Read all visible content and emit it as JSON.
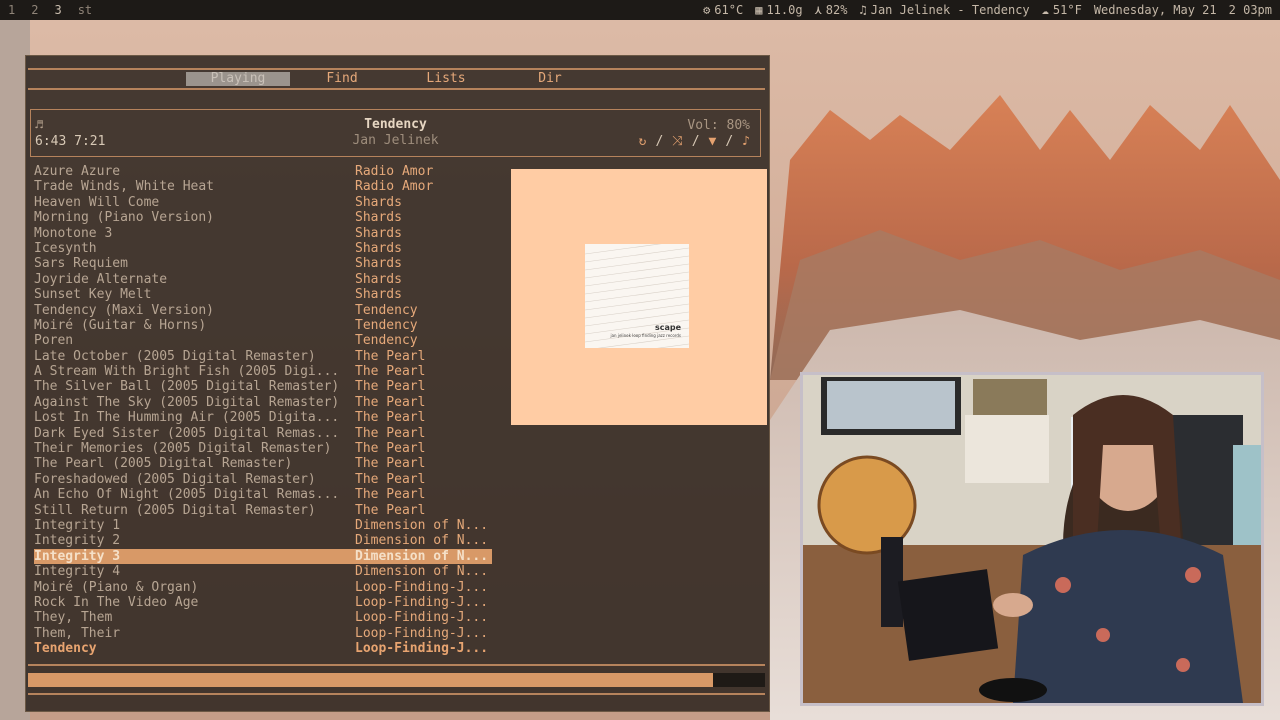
{
  "topbar": {
    "workspaces": [
      "1",
      "2",
      "3",
      "st"
    ],
    "temperature": "61°C",
    "memory": "11.0g",
    "brightness": "82%",
    "now_playing": "Jan Jelinek - Tendency",
    "weather": "51°F",
    "date": "Wednesday, May 21",
    "time": "2 03pm"
  },
  "player": {
    "tabs": [
      "Playing",
      "Find",
      "Lists",
      "Dir"
    ],
    "active_tab": "Playing",
    "title": "Tendency",
    "artist": "Jan Jelinek",
    "elapsed": "6:43",
    "duration": "7:21",
    "time_display": "6:43 7:21",
    "volume": "Vol: 80%",
    "progress": 0.93,
    "selected_index": 25,
    "playing_index": 31,
    "tracks": [
      {
        "title": "Azure Azure",
        "album": "Radio Amor"
      },
      {
        "title": "Trade Winds, White Heat",
        "album": "Radio Amor"
      },
      {
        "title": "Heaven Will Come",
        "album": "Shards"
      },
      {
        "title": "Morning (Piano Version)",
        "album": "Shards"
      },
      {
        "title": "Monotone 3",
        "album": "Shards"
      },
      {
        "title": "Icesynth",
        "album": "Shards"
      },
      {
        "title": "Sars Requiem",
        "album": "Shards"
      },
      {
        "title": "Joyride Alternate",
        "album": "Shards"
      },
      {
        "title": "Sunset Key Melt",
        "album": "Shards"
      },
      {
        "title": "Tendency (Maxi Version)",
        "album": "Tendency"
      },
      {
        "title": "Moiré (Guitar & Horns)",
        "album": "Tendency"
      },
      {
        "title": "Poren",
        "album": "Tendency"
      },
      {
        "title": "Late October (2005 Digital Remaster)",
        "album": "The Pearl"
      },
      {
        "title": "A Stream With Bright Fish (2005 Digi...",
        "album": "The Pearl"
      },
      {
        "title": "The Silver Ball (2005 Digital Remaster)",
        "album": "The Pearl"
      },
      {
        "title": "Against The Sky (2005 Digital Remaster)",
        "album": "The Pearl"
      },
      {
        "title": "Lost In The Humming Air (2005 Digita...",
        "album": "The Pearl"
      },
      {
        "title": "Dark Eyed Sister (2005 Digital Remas...",
        "album": "The Pearl"
      },
      {
        "title": "Their Memories (2005 Digital Remaster)",
        "album": "The Pearl"
      },
      {
        "title": "The Pearl (2005 Digital Remaster)",
        "album": "The Pearl"
      },
      {
        "title": "Foreshadowed (2005 Digital Remaster)",
        "album": "The Pearl"
      },
      {
        "title": "An Echo Of Night (2005 Digital Remas...",
        "album": "The Pearl"
      },
      {
        "title": "Still Return (2005 Digital Remaster)",
        "album": "The Pearl"
      },
      {
        "title": "Integrity 1",
        "album": "Dimension of N..."
      },
      {
        "title": "Integrity 2",
        "album": "Dimension of N..."
      },
      {
        "title": "Integrity 3",
        "album": "Dimension of N..."
      },
      {
        "title": "Integrity 4",
        "album": "Dimension of N..."
      },
      {
        "title": "Moiré (Piano & Organ)",
        "album": "Loop-Finding-J..."
      },
      {
        "title": "Rock In The Video Age",
        "album": "Loop-Finding-J..."
      },
      {
        "title": "They, Them",
        "album": "Loop-Finding-J..."
      },
      {
        "title": "Them, Their",
        "album": "Loop-Finding-J..."
      },
      {
        "title": "Tendency",
        "album": "Loop-Finding-J..."
      }
    ],
    "cover": {
      "title": "scape",
      "subtitle": "jan jelinek  loop finding jazz records"
    },
    "mode_icons": [
      "repeat-icon",
      "shuffle-icon",
      "single-icon",
      "consume-icon"
    ],
    "mode_separator": "/"
  },
  "colors": {
    "accent": "#d89967",
    "accent_text": "#e6a97a",
    "art_panel_bg": "#ffcca4"
  }
}
